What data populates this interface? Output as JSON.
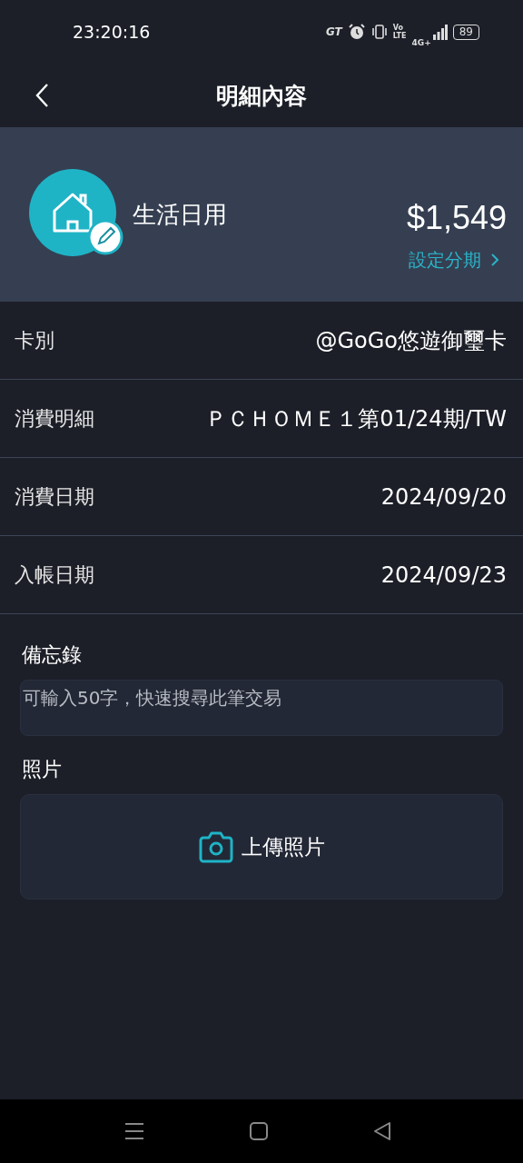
{
  "status_bar": {
    "time": "23:20:16",
    "gt": "GT",
    "volte_top": "Vo",
    "volte_bottom": "LTE",
    "network": "4G+",
    "battery": "89"
  },
  "header": {
    "title": "明細內容"
  },
  "summary": {
    "category": "生活日用",
    "amount": "$1,549",
    "installment_link": "設定分期"
  },
  "details": [
    {
      "label": "卡別",
      "value": "@GoGo悠遊御璽卡"
    },
    {
      "label": "消費明細",
      "value": "ＰＣＨＯＭＥ１第01/24期/TW"
    },
    {
      "label": "消費日期",
      "value": "2024/09/20"
    },
    {
      "label": "入帳日期",
      "value": "2024/09/23"
    }
  ],
  "memo": {
    "label": "備忘錄",
    "placeholder": "可輸入50字，快速搜尋此筆交易"
  },
  "photo": {
    "label": "照片",
    "upload_button": "上傳照片"
  }
}
